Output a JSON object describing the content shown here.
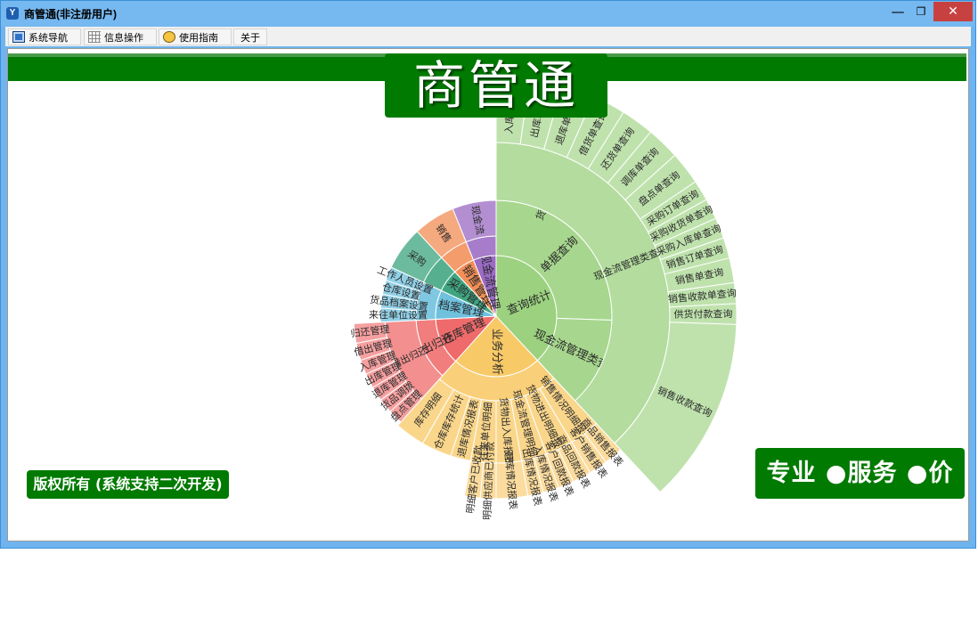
{
  "window": {
    "title": "商管通(非注册用户)",
    "app_icon": "app-logo-icon"
  },
  "controls": {
    "minimize": "—",
    "maximize": "❐",
    "close": "✕"
  },
  "menu": [
    {
      "label": "系统导航",
      "icon": "navigation-icon"
    },
    {
      "label": "信息操作",
      "icon": "grid-icon"
    },
    {
      "label": "使用指南",
      "icon": "guide-icon"
    },
    {
      "label": "关于",
      "icon": ""
    }
  ],
  "banner": {
    "logo_text": "商管通"
  },
  "copyright": "版权所有 (系统支持二次开发)",
  "slogan": "专业 ●服务 ●价值",
  "chart_data": {
    "type": "sunburst",
    "colors": {
      "查询统计": "#9bd17f",
      "业务分析": "#f8c967",
      "仓库管理": "#ef6b6b",
      "档案管理": "#6fc1de",
      "采购管理": "#3fa581",
      "销售管理": "#f28e57",
      "现金流管理": "#9b6bc4"
    },
    "inner": [
      {
        "name": "查询统计",
        "value": 137
      },
      {
        "name": "业务分析",
        "value": 85
      },
      {
        "name": "仓库管理",
        "value": 45
      },
      {
        "name": "档案管理",
        "value": 28
      },
      {
        "name": "采购管理",
        "value": 22
      },
      {
        "name": "销售管理",
        "value": 21
      },
      {
        "name": "现金流管理",
        "value": 22
      }
    ],
    "middle": [
      {
        "name": "单据查询",
        "value": 92,
        "parent": "查询统计"
      },
      {
        "name": "现金流管理类查询",
        "value": 45,
        "parent": "查询统计"
      },
      {
        "name": "",
        "value": 85,
        "parent": "业务分析"
      },
      {
        "name": "借出归还",
        "value": 45,
        "parent": "仓库管理"
      },
      {
        "name": "",
        "value": 28,
        "parent": "档案管理"
      },
      {
        "name": "",
        "value": 22,
        "parent": "采购管理"
      },
      {
        "name": "",
        "value": 21,
        "parent": "销售管理"
      },
      {
        "name": "",
        "value": 22,
        "parent": "现金流管理"
      }
    ],
    "outer": [
      {
        "name": "货物进出库类查询",
        "value": 48,
        "parent": "单据查询"
      },
      {
        "name": "采购类查询",
        "value": 23,
        "parent": "单据查询"
      },
      {
        "name": "销售类查询",
        "value": 21,
        "parent": "单据查询"
      },
      {
        "name": "现金流管理类查询",
        "value": 45,
        "parent": "查询统计"
      },
      {
        "name": "销售情况明细报表",
        "value": 12,
        "parent": "业务分析"
      },
      {
        "name": "货物进出明细报表",
        "value": 11,
        "parent": "业务分析"
      },
      {
        "name": "现金流管理明细表",
        "value": 10,
        "parent": "业务分析"
      },
      {
        "name": "货物出入库报表",
        "value": 10,
        "parent": "业务分析"
      },
      {
        "name": "往来单位明细",
        "value": 10,
        "parent": "业务分析"
      },
      {
        "name": "退库情况报表",
        "value": 8,
        "parent": "业务分析"
      },
      {
        "name": "仓库库存统计",
        "value": 12,
        "parent": "业务分析"
      },
      {
        "name": "库存明细",
        "value": 12,
        "parent": "业务分析"
      },
      {
        "name": "借出归还",
        "value": 45,
        "parent": "仓库管理"
      },
      {
        "name": "来往单位设置",
        "value": 7,
        "parent": "档案管理"
      },
      {
        "name": "货品档案设置",
        "value": 7,
        "parent": "档案管理"
      },
      {
        "name": "仓库设置",
        "value": 7,
        "parent": "档案管理"
      },
      {
        "name": "工作人员设置",
        "value": 7,
        "parent": "档案管理"
      },
      {
        "name": "采购",
        "value": 22,
        "parent": "采购管理"
      },
      {
        "name": "销售",
        "value": 21,
        "parent": "销售管理"
      },
      {
        "name": "现金流",
        "value": 22,
        "parent": "现金流管理"
      }
    ],
    "leaves": [
      {
        "name": "入库单查询",
        "value": 8,
        "parent": "货物进出库类查询"
      },
      {
        "name": "出库单查询",
        "value": 8,
        "parent": "货物进出库类查询"
      },
      {
        "name": "退库单查询",
        "value": 8,
        "parent": "货物进出库类查询"
      },
      {
        "name": "借货单查询",
        "value": 8,
        "parent": "货物进出库类查询"
      },
      {
        "name": "还货单查询",
        "value": 8,
        "parent": "货物进出库类查询"
      },
      {
        "name": "调库单查询",
        "value": 8,
        "parent": "货物进出库类查询"
      },
      {
        "name": "盘点单查询",
        "value": 8,
        "parent": "采购类查询"
      },
      {
        "name": "采购订单查询",
        "value": 5,
        "parent": "采购类查询"
      },
      {
        "name": "采购收货单查询",
        "value": 5,
        "parent": "采购类查询"
      },
      {
        "name": "采购入库单查询",
        "value": 5,
        "parent": "采购类查询"
      },
      {
        "name": "销售订单查询",
        "value": 5,
        "parent": "销售类查询"
      },
      {
        "name": "销售单查询",
        "value": 6,
        "parent": "销售类查询"
      },
      {
        "name": "销售收款单查询",
        "value": 5,
        "parent": "销售类查询"
      },
      {
        "name": "供货付款查询",
        "value": 5,
        "parent": "销售类查询"
      },
      {
        "name": "销售收款查询",
        "value": 6,
        "parent": "现金流管理类查询"
      },
      {
        "name": "商品销售报表",
        "value": 6,
        "parent": "销售情况明细报表"
      },
      {
        "name": "客户销售报表",
        "value": 6,
        "parent": "销售情况明细报表"
      },
      {
        "name": "商品回款报表",
        "value": 6,
        "parent": "货物进出明细报表"
      },
      {
        "name": "客户回款报表",
        "value": 5,
        "parent": "货物进出明细报表"
      },
      {
        "name": "入库情况报表",
        "value": 5,
        "parent": "现金流管理明细表"
      },
      {
        "name": "出库情况报表",
        "value": 5,
        "parent": "现金流管理明细表"
      },
      {
        "name": "退库情况报表",
        "value": 6,
        "parent": "货物出入库报表"
      },
      {
        "name": "明细供应商已付款",
        "value": 6,
        "parent": "往来单位明细"
      },
      {
        "name": "明细客户已收款",
        "value": 6,
        "parent": "往来单位明细"
      },
      {
        "name": "盘点管理",
        "value": 6,
        "parent": "借出归还"
      },
      {
        "name": "货品调拨",
        "value": 6,
        "parent": "借出归还"
      },
      {
        "name": "退库管理",
        "value": 6,
        "parent": "借出归还"
      },
      {
        "name": "出库管理",
        "value": 6,
        "parent": "借出归还"
      },
      {
        "name": "入库管理",
        "value": 6,
        "parent": "借出归还"
      },
      {
        "name": "借出管理",
        "value": 7,
        "parent": "借出归还"
      },
      {
        "name": "归还管理",
        "value": 8,
        "parent": "借出归还"
      }
    ]
  }
}
